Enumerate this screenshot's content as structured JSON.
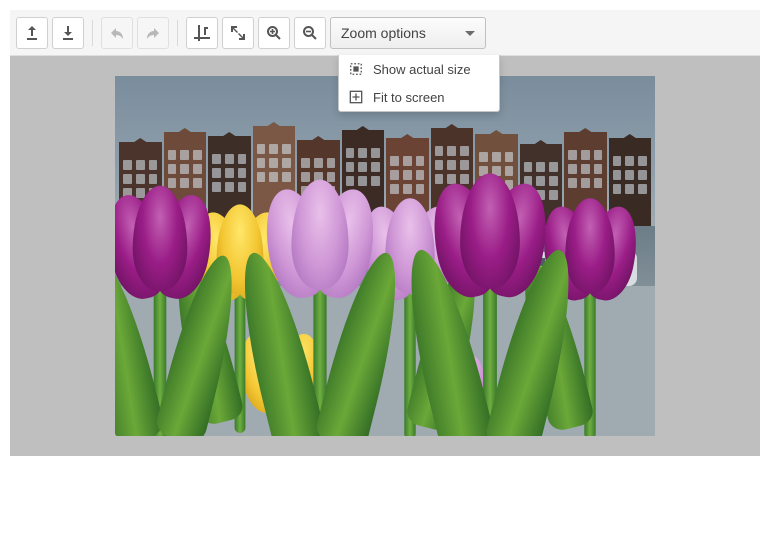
{
  "toolbar": {
    "upload_title": "Open",
    "download_title": "Download",
    "undo_title": "Undo",
    "redo_title": "Redo",
    "crop_title": "Crop",
    "resize_title": "Resize",
    "zoom_in_title": "Zoom in",
    "zoom_out_title": "Zoom out"
  },
  "zoom_dropdown": {
    "label": "Zoom options",
    "expanded": true,
    "items": [
      {
        "icon": "actual-size-icon",
        "label": "Show actual size"
      },
      {
        "icon": "fit-screen-icon",
        "label": "Fit to screen"
      }
    ]
  },
  "icons": {
    "upload": "upload-icon",
    "download": "download-icon",
    "undo": "undo-icon",
    "redo": "redo-icon",
    "crop": "crop-icon",
    "resize": "resize-icon",
    "zoom_in": "zoom-in-icon",
    "zoom_out": "zoom-out-icon",
    "dropdown_arrow": "chevron-down-icon"
  },
  "image": {
    "description": "Tulips in the foreground with Amsterdam canal houses behind",
    "fit_mode": "fit-to-screen"
  }
}
